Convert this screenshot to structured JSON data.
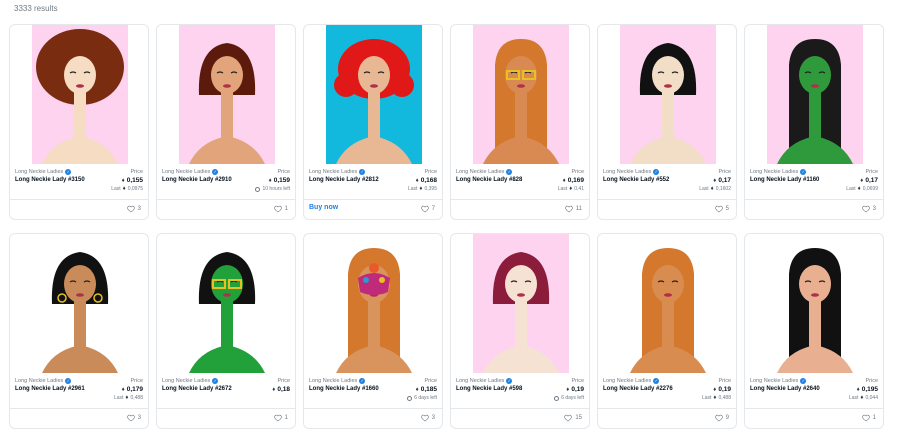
{
  "results": {
    "count_label": "3333 results"
  },
  "colors": {
    "accent": "#2081e2",
    "pink_bg": "#fdd3f0",
    "cyan_bg": "#12b9dc"
  },
  "cards": [
    {
      "collection": "Long Neckie Ladies",
      "name": "Long Neckie Lady #3150",
      "price_label": "Price",
      "price": "0,155",
      "sub": "Last",
      "sub_value": "0,0975",
      "likes": "3",
      "bg": "#fdd3f0",
      "skin": "#f5dcc2",
      "hair": "#7a2c10",
      "hair_style": "afro",
      "accent": "none"
    },
    {
      "collection": "Long Neckie Ladies",
      "name": "Long Neckie Lady #2910",
      "price_label": "Price",
      "price": "0,159",
      "sub": "10 hours left",
      "sub_value": "",
      "likes": "1",
      "bg": "#fdd3f0",
      "skin": "#e2a47a",
      "hair": "#5c1a0c",
      "hair_style": "bob",
      "accent": "none"
    },
    {
      "collection": "Long Neckie Ladies",
      "name": "Long Neckie Lady #2812",
      "price_label": "Price",
      "price": "0,168",
      "sub": "Last",
      "sub_value": "0,395",
      "likes": "7",
      "buy": "Buy now",
      "bg": "#12b9dc",
      "skin": "#e8b894",
      "hair": "#e01818",
      "hair_style": "curly",
      "accent": "none"
    },
    {
      "collection": "Long Neckie Ladies",
      "name": "Long Neckie Lady #828",
      "price_label": "Price",
      "price": "0,169",
      "sub": "Last",
      "sub_value": "0,41",
      "likes": "11",
      "bg": "#fdd3f0",
      "skin": "#d88a52",
      "hair": "#d4782e",
      "hair_style": "long",
      "accent": "glasses"
    },
    {
      "collection": "Long Neckie Ladies",
      "name": "Long Neckie Lady #552",
      "price_label": "Price",
      "price": "0,17",
      "sub": "Last",
      "sub_value": "0,1602",
      "likes": "5",
      "bg": "#fdd3f0",
      "skin": "#f2ddc6",
      "hair": "#111111",
      "hair_style": "bob",
      "accent": "none"
    },
    {
      "collection": "Long Neckie Ladies",
      "name": "Long Neckie Lady #1160",
      "price_label": "Price",
      "price": "0,17",
      "sub": "Last",
      "sub_value": "0,0699",
      "likes": "3",
      "bg": "#fdd3f0",
      "skin": "#2f9a3c",
      "hair": "#1a1a1a",
      "hair_style": "long",
      "accent": "none"
    },
    {
      "collection": "Long Neckie Ladies",
      "name": "Long Neckie Lady #2961",
      "price_label": "Price",
      "price": "0,179",
      "sub": "Last",
      "sub_value": "0,488",
      "likes": "3",
      "bg": "#ffffff",
      "skin": "#c98b5a",
      "hair": "#111111",
      "hair_style": "bob",
      "accent": "earrings"
    },
    {
      "collection": "Long Neckie Ladies",
      "name": "Long Neckie Lady #2672",
      "price_label": "Price",
      "price": "0,18",
      "sub": "",
      "sub_value": "",
      "likes": "1",
      "bg": "#ffffff",
      "skin": "#22a03a",
      "hair": "#111111",
      "hair_style": "bob",
      "accent": "glasses"
    },
    {
      "collection": "Long Neckie Ladies",
      "name": "Long Neckie Lady #1660",
      "price_label": "Price",
      "price": "0,185",
      "sub": "6 days left",
      "sub_value": "",
      "likes": "3",
      "bg": "#ffffff",
      "skin": "#d9935c",
      "hair": "#d4782e",
      "hair_style": "long",
      "accent": "mask"
    },
    {
      "collection": "Long Neckie Ladies",
      "name": "Long Neckie Lady #598",
      "price_label": "Price",
      "price": "0,19",
      "sub": "6 days left",
      "sub_value": "",
      "likes": "15",
      "bg": "#fdd3f0",
      "skin": "#f6e2d2",
      "hair": "#8c1c3c",
      "hair_style": "bob",
      "accent": "none"
    },
    {
      "collection": "Long Neckie Ladies",
      "name": "Long Neckie Lady #2276",
      "price_label": "Price",
      "price": "0,19",
      "sub": "Last",
      "sub_value": "0,488",
      "likes": "9",
      "bg": "#ffffff",
      "skin": "#d98c50",
      "hair": "#d4782e",
      "hair_style": "long",
      "accent": "none"
    },
    {
      "collection": "Long Neckie Ladies",
      "name": "Long Neckie Lady #2640",
      "price_label": "Price",
      "price": "0,195",
      "sub": "Last",
      "sub_value": "0,044",
      "likes": "1",
      "bg": "#ffffff",
      "skin": "#e8b090",
      "hair": "#111111",
      "hair_style": "long",
      "accent": "none"
    }
  ]
}
